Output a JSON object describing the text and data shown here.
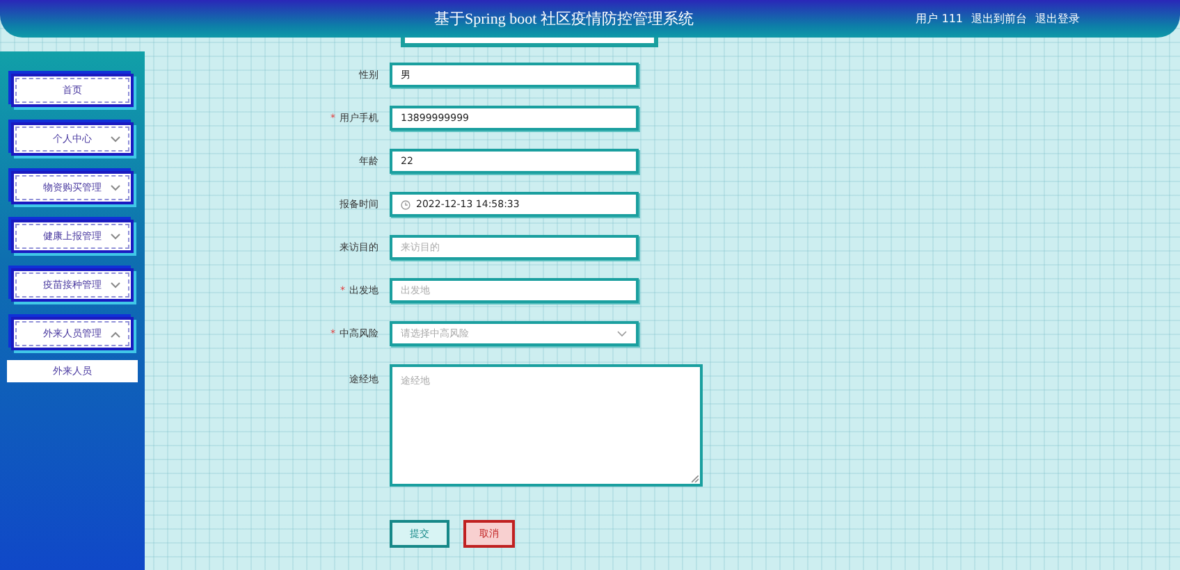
{
  "header": {
    "title": "基于Spring boot 社区疫情防控管理系统",
    "user": "用户 111",
    "links": [
      "退出到前台",
      "退出登录"
    ]
  },
  "sidebar": {
    "items": [
      {
        "label": "首页"
      },
      {
        "label": "个人中心",
        "expanded": false
      },
      {
        "label": "物资购买管理",
        "expanded": false
      },
      {
        "label": "健康上报管理",
        "expanded": false
      },
      {
        "label": "疫苗接种管理",
        "expanded": false
      },
      {
        "label": "外来人员管理",
        "expanded": true,
        "children": [
          {
            "label": "外来人员"
          }
        ]
      }
    ]
  },
  "form": {
    "fields": [
      {
        "label": "性别",
        "kind": "text",
        "value": "男"
      },
      {
        "label": "用户手机",
        "kind": "text",
        "mark": "*",
        "value": "13899999999"
      },
      {
        "label": "年龄",
        "kind": "text",
        "value": "22"
      },
      {
        "label": "报备时间",
        "kind": "date",
        "value": "2022-12-13 14:58:33"
      },
      {
        "label": "来访目的",
        "kind": "text",
        "placeholder": "来访目的"
      },
      {
        "label": "出发地",
        "kind": "text",
        "mark": "*",
        "placeholder": "出发地"
      },
      {
        "label": "中高风险",
        "kind": "select",
        "mark": "*",
        "placeholder": "请选择中高风险"
      },
      {
        "label": "途经地",
        "kind": "textarea",
        "placeholder": "途经地"
      }
    ],
    "buttons": [
      {
        "label": "提交",
        "kind": "primary"
      },
      {
        "label": "取消",
        "kind": "danger"
      }
    ]
  }
}
